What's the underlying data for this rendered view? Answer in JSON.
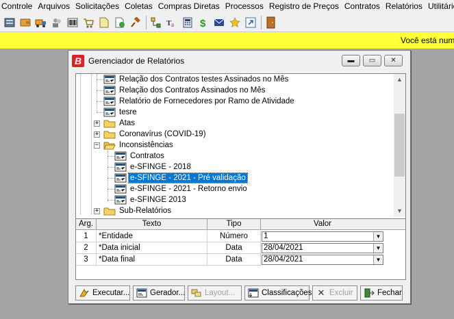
{
  "menu": [
    "Controle",
    "Arquivos",
    "Solicitações",
    "Coletas",
    "Compras Diretas",
    "Processos",
    "Registro de Preços",
    "Contratos",
    "Relatórios",
    "Utilitários"
  ],
  "toolbar_icons": [
    "db-connect-icon",
    "wallet-icon",
    "truck-icon",
    "users-icon",
    "barcode-icon",
    "cart-icon",
    "document-icon",
    "document-check-icon",
    "gavel-icon",
    "flowchart-icon",
    "text-format-icon",
    "calculator-icon",
    "dollar-icon",
    "mail-icon",
    "star-icon",
    "shortcut-icon",
    "exit-door-icon"
  ],
  "banner": {
    "text": "Você está num"
  },
  "dialog": {
    "title": "Gerenciador de Relatórios",
    "controls": {
      "minimize": "▬",
      "maximize": "▭",
      "close": "✕"
    }
  },
  "tree": {
    "items": [
      {
        "label": "Relação dos Contratos  testes Assinados no Mês",
        "type": "report"
      },
      {
        "label": "Relação dos Contratos Assinados no Mês",
        "type": "report"
      },
      {
        "label": "Relatório de Fornecedores por Ramo de Atividade",
        "type": "report"
      },
      {
        "label": "tesre",
        "type": "report"
      },
      {
        "label": "Atas",
        "type": "folder",
        "expander": "+"
      },
      {
        "label": "Coronavírus (COVID-19)",
        "type": "folder",
        "expander": "+"
      },
      {
        "label": "Inconsistências",
        "type": "folder-open",
        "expander": "−"
      },
      {
        "label": "Contratos",
        "type": "report"
      },
      {
        "label": "e-SFINGE - 2018",
        "type": "report"
      },
      {
        "label": "e-SFINGE - 2021 - Pré validação",
        "type": "report",
        "selected": true
      },
      {
        "label": "e-SFINGE - 2021 - Retorno envio",
        "type": "report"
      },
      {
        "label": "e-SFINGE 2013",
        "type": "report"
      },
      {
        "label": "Sub-Relatórios",
        "type": "folder",
        "expander": "+"
      }
    ]
  },
  "params": {
    "headers": {
      "arg": "Arg.",
      "texto": "Texto",
      "tipo": "Tipo",
      "valor": "Valor"
    },
    "rows": [
      {
        "arg": "1",
        "texto": "*Entidade",
        "tipo": "Número",
        "valor": "1"
      },
      {
        "arg": "2",
        "texto": "*Data inicial",
        "tipo": "Data",
        "valor": "28/04/2021"
      },
      {
        "arg": "3",
        "texto": "*Data final",
        "tipo": "Data",
        "valor": "28/04/2021"
      }
    ]
  },
  "buttons": {
    "executar": "Executar...",
    "gerador": "Gerador...",
    "layout": "Layout...",
    "classificacoes": "Classificações",
    "excluir": "Excluir",
    "fechar": "Fechar"
  },
  "colors": {
    "banner": "#ffff38",
    "selection": "#0078d7",
    "annotation_arrow": "#d83a5a",
    "logo": "#d8232a"
  }
}
